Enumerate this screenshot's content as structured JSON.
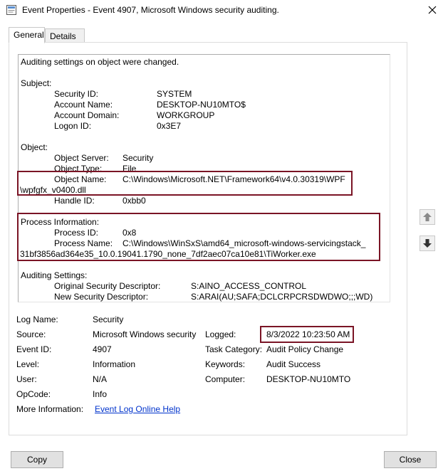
{
  "window": {
    "title": "Event Properties - Event 4907, Microsoft Windows security auditing."
  },
  "tabs": [
    {
      "label": "General",
      "active": true
    },
    {
      "label": "Details",
      "active": false
    }
  ],
  "description": {
    "lines": [
      "Auditing settings on object were changed.",
      "Subject:",
      "Security ID:",
      "SYSTEM",
      "Account Name:",
      "DESKTOP-NU10MTO$",
      "Account Domain:",
      "WORKGROUP",
      "Logon ID:",
      "0x3E7",
      "Object:",
      "Object Server:",
      "Security",
      "Object Type:",
      "File",
      "Object Name:",
      "C:\\Windows\\Microsoft.NET\\Framework64\\v4.0.30319\\WPF",
      "\\wpfgfx_v0400.dll",
      "Handle ID:",
      "0xbb0",
      "Process Information:",
      "Process ID:",
      "0x8",
      "Process Name:",
      "C:\\Windows\\WinSxS\\amd64_microsoft-windows-servicingstack_",
      "31bf3856ad364e35_10.0.19041.1790_none_7df2aec07ca10e81\\TiWorker.exe",
      "Auditing Settings:",
      "Original Security Descriptor:",
      "S:AINO_ACCESS_CONTROL",
      "New Security Descriptor:",
      "S:ARAI(AU;SAFA;DCLCRPCRSDWDWO;;;WD)"
    ]
  },
  "details": {
    "log_name_label": "Log Name:",
    "log_name": "Security",
    "source_label": "Source:",
    "source": "Microsoft Windows security",
    "logged_label": "Logged:",
    "logged": "8/3/2022 10:23:50 AM",
    "event_id_label": "Event ID:",
    "event_id": "4907",
    "task_category_label": "Task Category:",
    "task_category": "Audit Policy Change",
    "level_label": "Level:",
    "level": "Information",
    "keywords_label": "Keywords:",
    "keywords": "Audit Success",
    "user_label": "User:",
    "user": "N/A",
    "computer_label": "Computer:",
    "computer": "DESKTOP-NU10MTO",
    "opcode_label": "OpCode:",
    "opcode": "Info",
    "more_info_label": "More Information:",
    "more_info_link": "Event Log Online Help"
  },
  "buttons": {
    "copy": "Copy",
    "close": "Close"
  },
  "icons": {
    "app": "event-properties-icon",
    "close": "close-icon",
    "up": "arrow-up-icon",
    "down": "arrow-down-icon"
  },
  "colors": {
    "highlight": "#7a1425",
    "link": "#0033cc"
  }
}
